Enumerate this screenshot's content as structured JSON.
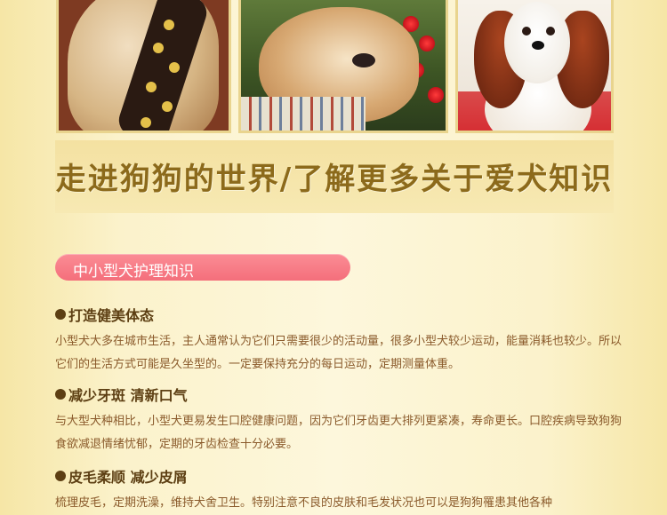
{
  "headline": "走进狗狗的世界/了解更多关于爱犬知识",
  "section": {
    "label": "中小型犬护理知识",
    "color": "#f46f7b"
  },
  "photos": [
    {
      "subject": "golden dog wearing skull-pattern tie"
    },
    {
      "subject": "sleeping bulldog puppy"
    },
    {
      "subject": "cavalier king charles spaniel"
    }
  ],
  "tips": [
    {
      "title": "打造健美体态",
      "text": "小型犬大多在城市生活，主人通常认为它们只需要很少的活动量，很多小型犬较少运动，能量消耗也较少。所以它们的生活方式可能是久坐型的。一定要保持充分的每日运动，定期测量体重。"
    },
    {
      "title": "减少牙斑  清新口气",
      "text": "与大型犬种相比，小型犬更易发生口腔健康问题，因为它们牙齿更大排列更紧凑，寿命更长。口腔疾病导致狗狗食欲减退情绪忧郁，定期的牙齿检查十分必要。"
    },
    {
      "title": "皮毛柔顺  减少皮屑",
      "text": "梳理皮毛，定期洗澡，维持犬舍卫生。特别注意不良的皮肤和毛发状况也可以是狗狗罹患其他各种"
    }
  ],
  "colors": {
    "title_text": "#8c6a1b",
    "tip_title": "#5d3f13",
    "tip_text": "#8a5a2b",
    "background": "#fbf2cb"
  }
}
